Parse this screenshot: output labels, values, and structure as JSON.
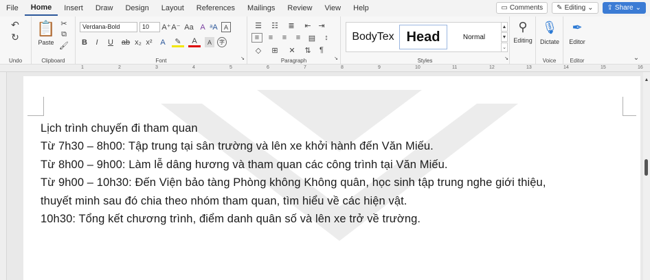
{
  "menu": {
    "items": [
      "File",
      "Home",
      "Insert",
      "Draw",
      "Design",
      "Layout",
      "References",
      "Mailings",
      "Review",
      "View",
      "Help"
    ],
    "active": "Home",
    "comments_label": "Comments",
    "editing_label": "Editing",
    "share_label": "Share"
  },
  "ribbon": {
    "undo": {
      "label": "Undo"
    },
    "clipboard": {
      "paste_label": "Paste",
      "group_label": "Clipboard"
    },
    "font": {
      "font_name": "Verdana-Bold",
      "font_size": "10",
      "group_label": "Font"
    },
    "paragraph": {
      "group_label": "Paragraph"
    },
    "styles": {
      "items": [
        "BodyTex",
        "Head",
        "Normal"
      ],
      "group_label": "Styles"
    },
    "editing": {
      "label": "Editing"
    },
    "voice": {
      "dictate_label": "Dictate",
      "group_label": "Voice"
    },
    "editor": {
      "editor_label": "Editor",
      "group_label": "Editor"
    }
  },
  "ruler": {
    "numbers": [
      "1",
      "2",
      "3",
      "4",
      "5",
      "6",
      "7",
      "8",
      "9",
      "10",
      "11",
      "12",
      "13",
      "14",
      "15",
      "16"
    ]
  },
  "document": {
    "lines": [
      "Lịch trình chuyến đi tham quan",
      "Từ 7h30 – 8h00: Tập trung tại sân trường và lên xe khởi hành đến Văn Miếu.",
      "Từ 8h00 – 9h00: Làm lễ dâng hương và tham quan các công trình tại Văn Miếu.",
      "Từ 9h00 – 10h30: Đến Viện bảo tàng Phòng không Không quân, học sinh tập trung nghe giới thiệu,",
      "thuyết minh sau đó chia theo nhóm tham quan, tìm hiểu về các hiện vật.",
      "10h30: Tổng kết chương trình, điểm danh quân số và lên xe trở về trường."
    ]
  },
  "colors": {
    "accent": "#2b579a",
    "share": "#3b7bd4"
  }
}
